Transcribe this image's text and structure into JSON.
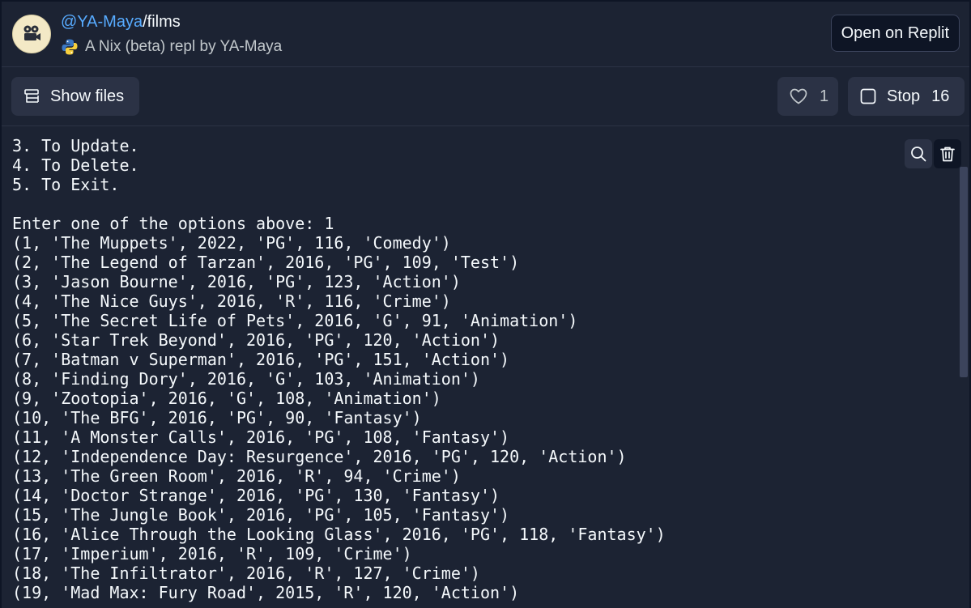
{
  "header": {
    "owner": "@YA-Maya",
    "separator": "/",
    "repl_name": "films",
    "subtitle": "A Nix (beta) repl by YA-Maya",
    "open_button": "Open on Replit"
  },
  "toolbar": {
    "show_files_label": "Show files",
    "like_count": "1",
    "stop_label": "Stop",
    "stop_count": "16"
  },
  "console": {
    "lines": [
      "3. To Update.",
      "4. To Delete.",
      "5. To Exit.",
      "",
      "Enter one of the options above: 1",
      "(1, 'The Muppets', 2022, 'PG', 116, 'Comedy')",
      "(2, 'The Legend of Tarzan', 2016, 'PG', 109, 'Test')",
      "(3, 'Jason Bourne', 2016, 'PG', 123, 'Action')",
      "(4, 'The Nice Guys', 2016, 'R', 116, 'Crime')",
      "(5, 'The Secret Life of Pets', 2016, 'G', 91, 'Animation')",
      "(6, 'Star Trek Beyond', 2016, 'PG', 120, 'Action')",
      "(7, 'Batman v Superman', 2016, 'PG', 151, 'Action')",
      "(8, 'Finding Dory', 2016, 'G', 103, 'Animation')",
      "(9, 'Zootopia', 2016, 'G', 108, 'Animation')",
      "(10, 'The BFG', 2016, 'PG', 90, 'Fantasy')",
      "(11, 'A Monster Calls', 2016, 'PG', 108, 'Fantasy')",
      "(12, 'Independence Day: Resurgence', 2016, 'PG', 120, 'Action')",
      "(13, 'The Green Room', 2016, 'R', 94, 'Crime')",
      "(14, 'Doctor Strange', 2016, 'PG', 130, 'Fantasy')",
      "(15, 'The Jungle Book', 2016, 'PG', 105, 'Fantasy')",
      "(16, 'Alice Through the Looking Glass', 2016, 'PG', 118, 'Fantasy')",
      "(17, 'Imperium', 2016, 'R', 109, 'Crime')",
      "(18, 'The Infiltrator', 2016, 'R', 127, 'Crime')",
      "(19, 'Mad Max: Fury Road', 2015, 'R', 120, 'Action')"
    ]
  },
  "icons": {
    "avatar": "film-camera-icon",
    "language": "python-icon",
    "files": "file-tree-icon",
    "like": "heart-icon",
    "stop": "stop-square-icon",
    "search": "search-icon",
    "clear": "trash-icon"
  },
  "colors": {
    "background": "#1c2333",
    "outer_background": "#0e1525",
    "button": "#2b3245",
    "link": "#57abff",
    "text": "#f5f9fc"
  }
}
